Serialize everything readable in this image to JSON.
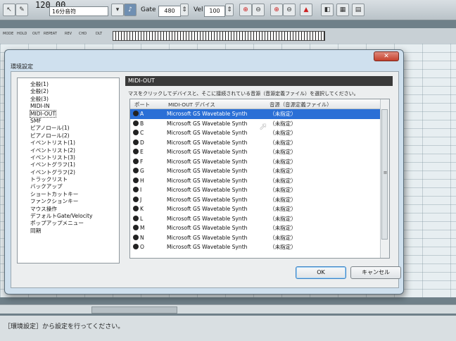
{
  "toolbar": {
    "tempo": "120.00",
    "note_value": "16分音符",
    "gate_label": "Gate",
    "gate_value": "480",
    "vel_label": "Vel",
    "vel_value": "100"
  },
  "track_header": {
    "labels": [
      "MODE",
      "HOLD",
      "OUT",
      "REPEAT",
      "REV",
      "CHD",
      "DLT"
    ]
  },
  "dialog": {
    "title": "環境設定",
    "close_label": "✕",
    "tree_items": [
      "全般(1)",
      "全般(2)",
      "全般(3)",
      "MIDI-IN",
      "MIDI-OUT",
      "SMF",
      "ピアノロール(1)",
      "ピアノロール(2)",
      "イベントリスト(1)",
      "イベントリスト(2)",
      "イベントリスト(3)",
      "イベントグラフ(1)",
      "イベントグラフ(2)",
      "トラックリスト",
      "バックアップ",
      "ショートカットキー",
      "ファンクションキー",
      "マウス操作",
      "デフォルトGate/Velocity",
      "ポップアップメニュー",
      "同期"
    ],
    "selected_tree_item": "MIDI-OUT",
    "panel_title": "MIDI-OUT",
    "instruction": "マスをクリックしてデバイスと、そこに接続されている音源（音源定義ファイル）を選択してください。",
    "columns": {
      "port": "ポート",
      "device": "MIDI-OUT デバイス",
      "source": "音源（音源定義ファイル）"
    },
    "rows": [
      {
        "port": "A",
        "device": "Microsoft GS Wavetable Synth",
        "source": "（未指定）"
      },
      {
        "port": "B",
        "device": "Microsoft GS Wavetable Synth",
        "source": "（未指定）"
      },
      {
        "port": "C",
        "device": "Microsoft GS Wavetable Synth",
        "source": "（未指定）"
      },
      {
        "port": "D",
        "device": "Microsoft GS Wavetable Synth",
        "source": "（未指定）"
      },
      {
        "port": "E",
        "device": "Microsoft GS Wavetable Synth",
        "source": "（未指定）"
      },
      {
        "port": "F",
        "device": "Microsoft GS Wavetable Synth",
        "source": "（未指定）"
      },
      {
        "port": "G",
        "device": "Microsoft GS Wavetable Synth",
        "source": "（未指定）"
      },
      {
        "port": "H",
        "device": "Microsoft GS Wavetable Synth",
        "source": "（未指定）"
      },
      {
        "port": "I",
        "device": "Microsoft GS Wavetable Synth",
        "source": "（未指定）"
      },
      {
        "port": "J",
        "device": "Microsoft GS Wavetable Synth",
        "source": "（未指定）"
      },
      {
        "port": "K",
        "device": "Microsoft GS Wavetable Synth",
        "source": "（未指定）"
      },
      {
        "port": "L",
        "device": "Microsoft GS Wavetable Synth",
        "source": "（未指定）"
      },
      {
        "port": "M",
        "device": "Microsoft GS Wavetable Synth",
        "source": "（未指定）"
      },
      {
        "port": "N",
        "device": "Microsoft GS Wavetable Synth",
        "source": "（未指定）"
      },
      {
        "port": "O",
        "device": "Microsoft GS Wavetable Synth",
        "source": "（未指定）"
      }
    ],
    "selected_row": "A",
    "ok_label": "OK",
    "cancel_label": "キャンセル"
  },
  "statusbar": {
    "text": "［環境設定］から設定を行ってください。"
  },
  "colors": {
    "selection": "#2a6fd6",
    "close_button": "#c4402c",
    "dialog_frame": "#cfe0ee"
  }
}
